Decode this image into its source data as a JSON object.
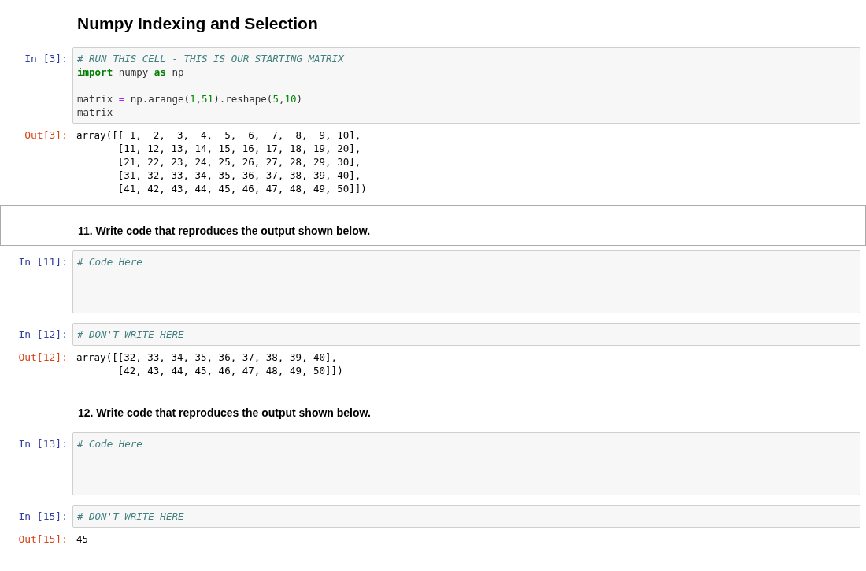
{
  "title": "Numpy Indexing and Selection",
  "cells": [
    {
      "kind": "code",
      "selected": false,
      "prompt": "In [3]:",
      "blocks": [
        [
          [
            {
              "kind": "comment",
              "text": "# RUN THIS CELL - THIS IS OUR STARTING MATRIX"
            }
          ],
          [
            {
              "kind": "keyword",
              "text": "import"
            },
            {
              "kind": "plain",
              "text": " numpy "
            },
            {
              "kind": "keyword",
              "text": "as"
            },
            {
              "kind": "plain",
              "text": " np"
            }
          ]
        ],
        [
          [
            {
              "kind": "plain",
              "text": "matrix "
            },
            {
              "kind": "operator",
              "text": "="
            },
            {
              "kind": "plain",
              "text": " np.arange("
            },
            {
              "kind": "number",
              "text": "1"
            },
            {
              "kind": "plain",
              "text": ","
            },
            {
              "kind": "number",
              "text": "51"
            },
            {
              "kind": "plain",
              "text": ").reshape("
            },
            {
              "kind": "number",
              "text": "5"
            },
            {
              "kind": "plain",
              "text": ","
            },
            {
              "kind": "number",
              "text": "10"
            },
            {
              "kind": "plain",
              "text": ")"
            }
          ],
          [
            {
              "kind": "plain",
              "text": "matrix"
            }
          ]
        ]
      ],
      "output": {
        "prompt": "Out[3]:",
        "lines": [
          "array([[ 1,  2,  3,  4,  5,  6,  7,  8,  9, 10],",
          "       [11, 12, 13, 14, 15, 16, 17, 18, 19, 20],",
          "       [21, 22, 23, 24, 25, 26, 27, 28, 29, 30],",
          "       [31, 32, 33, 34, 35, 36, 37, 38, 39, 40],",
          "       [41, 42, 43, 44, 45, 46, 47, 48, 49, 50]])"
        ]
      }
    },
    {
      "kind": "markdown",
      "selected": true,
      "text": "11. Write code that reproduces the output shown below."
    },
    {
      "kind": "scratch",
      "selected": false,
      "prompt": "In [11]:",
      "blocks": [
        [
          [
            {
              "kind": "comment",
              "text": "# Code Here"
            }
          ]
        ]
      ]
    },
    {
      "kind": "code",
      "selected": false,
      "prompt": "In [12]:",
      "blocks": [
        [
          [
            {
              "kind": "comment",
              "text": "# DON'T WRITE HERE"
            }
          ]
        ]
      ],
      "output": {
        "prompt": "Out[12]:",
        "lines": [
          "array([[32, 33, 34, 35, 36, 37, 38, 39, 40],",
          "       [42, 43, 44, 45, 46, 47, 48, 49, 50]])"
        ]
      }
    },
    {
      "kind": "markdown",
      "selected": false,
      "text": "12. Write code that reproduces the output shown below."
    },
    {
      "kind": "scratch",
      "selected": false,
      "prompt": "In [13]:",
      "blocks": [
        [
          [
            {
              "kind": "comment",
              "text": "# Code Here"
            }
          ]
        ]
      ]
    },
    {
      "kind": "code",
      "selected": false,
      "prompt": "In [15]:",
      "blocks": [
        [
          [
            {
              "kind": "comment",
              "text": "# DON'T WRITE HERE"
            }
          ]
        ]
      ],
      "output": {
        "prompt": "Out[15]:",
        "lines": [
          "45"
        ]
      }
    }
  ]
}
